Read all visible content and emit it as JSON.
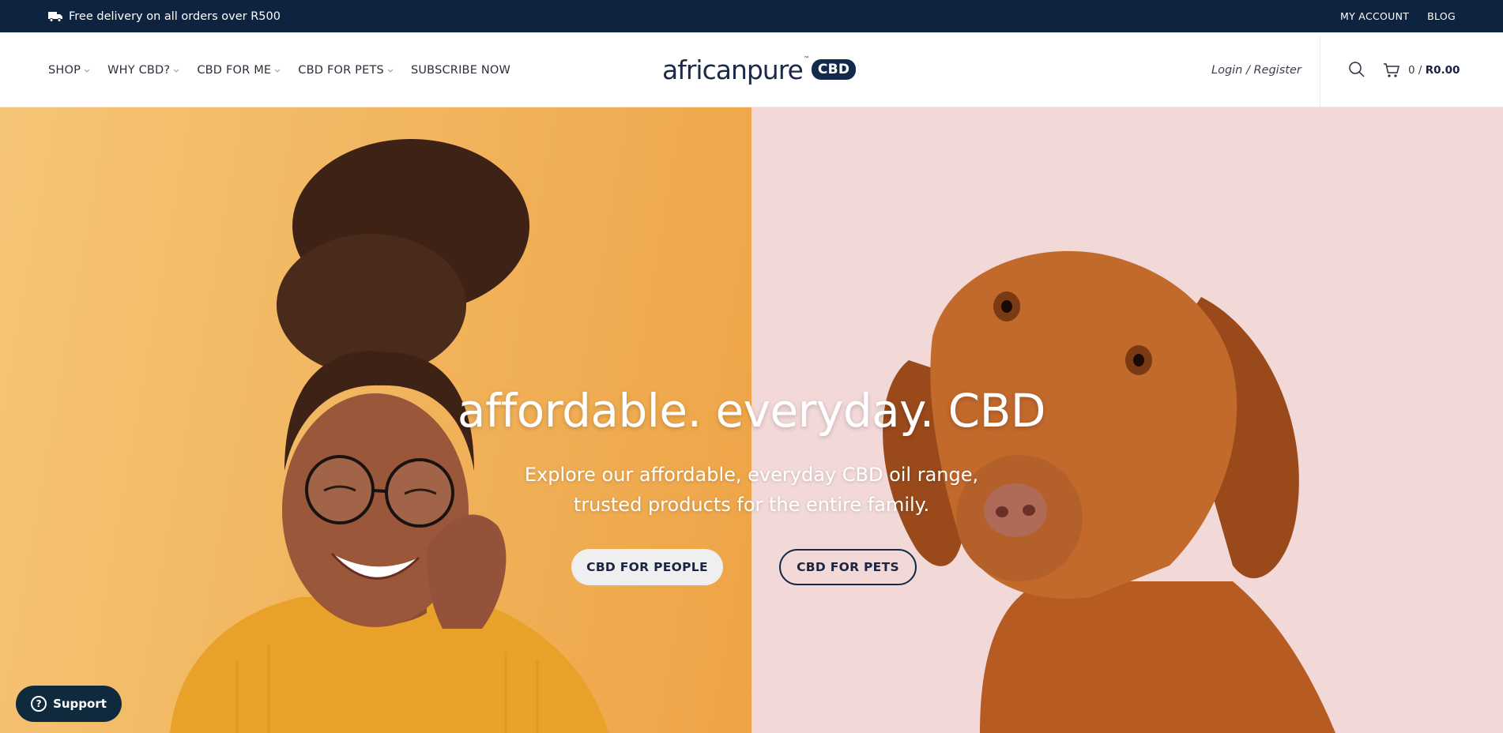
{
  "topbar": {
    "promo_icon": "truck-icon",
    "promo_text": "Free delivery on all orders over R500",
    "links": [
      "MY ACCOUNT",
      "BLOG"
    ]
  },
  "nav": {
    "items": [
      {
        "label": "SHOP",
        "has_dropdown": true
      },
      {
        "label": "WHY CBD?",
        "has_dropdown": true
      },
      {
        "label": "CBD FOR ME",
        "has_dropdown": true
      },
      {
        "label": "CBD FOR PETS",
        "has_dropdown": true
      },
      {
        "label": "SUBSCRIBE NOW",
        "has_dropdown": false
      }
    ]
  },
  "logo": {
    "word": "africanpure",
    "tm": "™",
    "badge": "CBD"
  },
  "account": {
    "login_label": "Login / Register"
  },
  "cart": {
    "count": "0 /",
    "amount": "R0.00"
  },
  "hero": {
    "title": "affordable. everyday. CBD",
    "subtitle_line1": "Explore our affordable, everyday CBD oil range,",
    "subtitle_line2": "trusted products for the entire family.",
    "btn_people": "CBD FOR PEOPLE",
    "btn_pets": "CBD FOR PETS"
  },
  "support": {
    "label": "Support"
  },
  "colors": {
    "topbar_bg": "#0e2340",
    "brand_navy": "#132a4a",
    "hero_left": "#f2b660",
    "hero_right": "#f2d9d8"
  }
}
